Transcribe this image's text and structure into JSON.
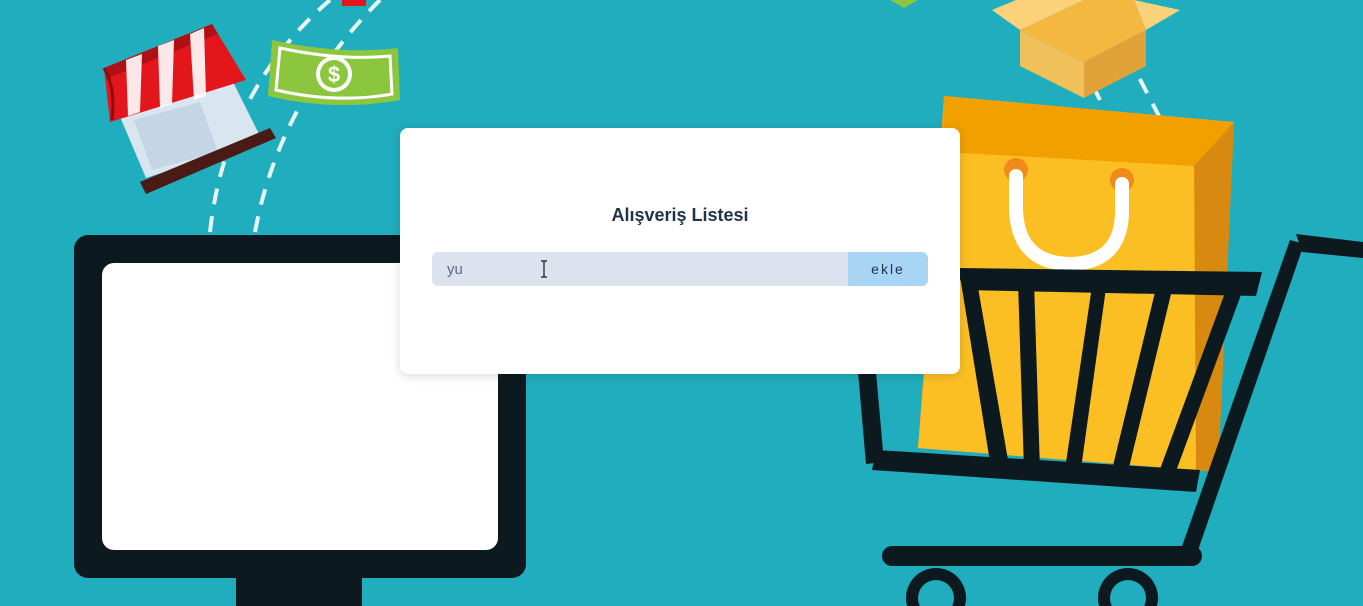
{
  "card": {
    "title": "Alışveriş Listesi"
  },
  "form": {
    "input_value": "yu",
    "add_label": "ekle"
  },
  "colors": {
    "background": "#20adbd",
    "card": "#ffffff",
    "input_bg": "#dce3ee",
    "button_bg": "#a9d5f5",
    "title": "#1f3448"
  },
  "illustration_icons": [
    "store-icon",
    "money-bill-icon",
    "computer-monitor-icon",
    "box-icon",
    "shopping-bag-icon",
    "shopping-cart-icon"
  ]
}
